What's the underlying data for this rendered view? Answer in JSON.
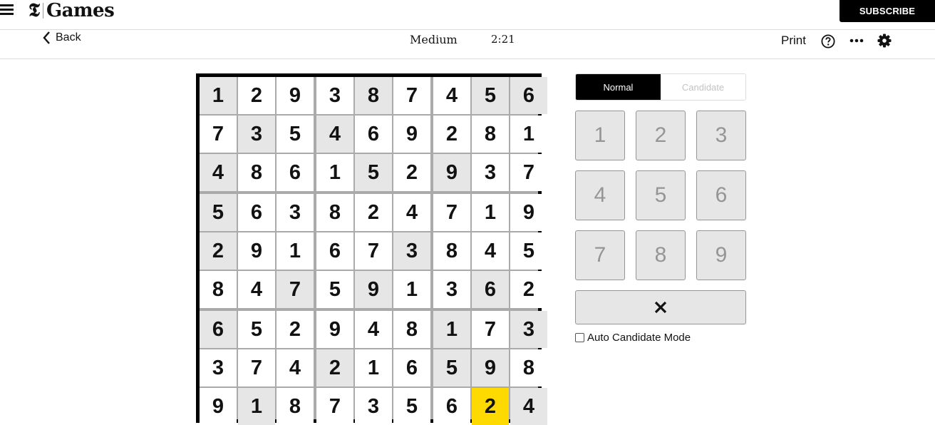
{
  "header": {
    "logo_mark": "𝕿",
    "logo_text": "Games",
    "subscribe_label": "SUBSCRIBE"
  },
  "toolbar": {
    "back_label": "Back",
    "difficulty": "Medium",
    "timer": "2:21",
    "print_label": "Print",
    "icons": [
      "help-icon",
      "more-icon",
      "settings-icon"
    ]
  },
  "board": {
    "rows": [
      [
        1,
        2,
        9,
        3,
        8,
        7,
        4,
        5,
        6
      ],
      [
        7,
        3,
        5,
        4,
        6,
        9,
        2,
        8,
        1
      ],
      [
        4,
        8,
        6,
        1,
        5,
        2,
        9,
        3,
        7
      ],
      [
        5,
        6,
        3,
        8,
        2,
        4,
        7,
        1,
        9
      ],
      [
        2,
        9,
        1,
        6,
        7,
        3,
        8,
        4,
        5
      ],
      [
        8,
        4,
        7,
        5,
        9,
        1,
        3,
        6,
        2
      ],
      [
        6,
        5,
        2,
        9,
        4,
        8,
        1,
        7,
        3
      ],
      [
        3,
        7,
        4,
        2,
        1,
        6,
        5,
        9,
        8
      ],
      [
        9,
        1,
        8,
        7,
        3,
        5,
        6,
        2,
        4
      ]
    ],
    "givens": [
      [
        1,
        0,
        0,
        0,
        1,
        0,
        0,
        1,
        1
      ],
      [
        0,
        1,
        0,
        1,
        0,
        0,
        0,
        0,
        0
      ],
      [
        1,
        0,
        0,
        0,
        1,
        0,
        1,
        0,
        0
      ],
      [
        1,
        0,
        0,
        0,
        0,
        0,
        0,
        0,
        0
      ],
      [
        1,
        0,
        0,
        0,
        0,
        1,
        0,
        0,
        0
      ],
      [
        0,
        0,
        1,
        0,
        1,
        0,
        0,
        1,
        0
      ],
      [
        1,
        0,
        0,
        0,
        0,
        0,
        1,
        0,
        1
      ],
      [
        0,
        0,
        0,
        1,
        0,
        0,
        1,
        1,
        0
      ],
      [
        0,
        1,
        0,
        0,
        0,
        0,
        0,
        0,
        1
      ]
    ],
    "selected": [
      8,
      7
    ],
    "colors": {
      "given": "#e6e6e6",
      "selected": "#ffda00",
      "empty": "#ffffff"
    }
  },
  "controls": {
    "modes": [
      {
        "label": "Normal",
        "active": true
      },
      {
        "label": "Candidate",
        "active": false
      }
    ],
    "numpad": [
      "1",
      "2",
      "3",
      "4",
      "5",
      "6",
      "7",
      "8",
      "9"
    ],
    "delete_icon": "close-icon",
    "auto_candidate_label": "Auto Candidate Mode",
    "auto_candidate_checked": false
  }
}
